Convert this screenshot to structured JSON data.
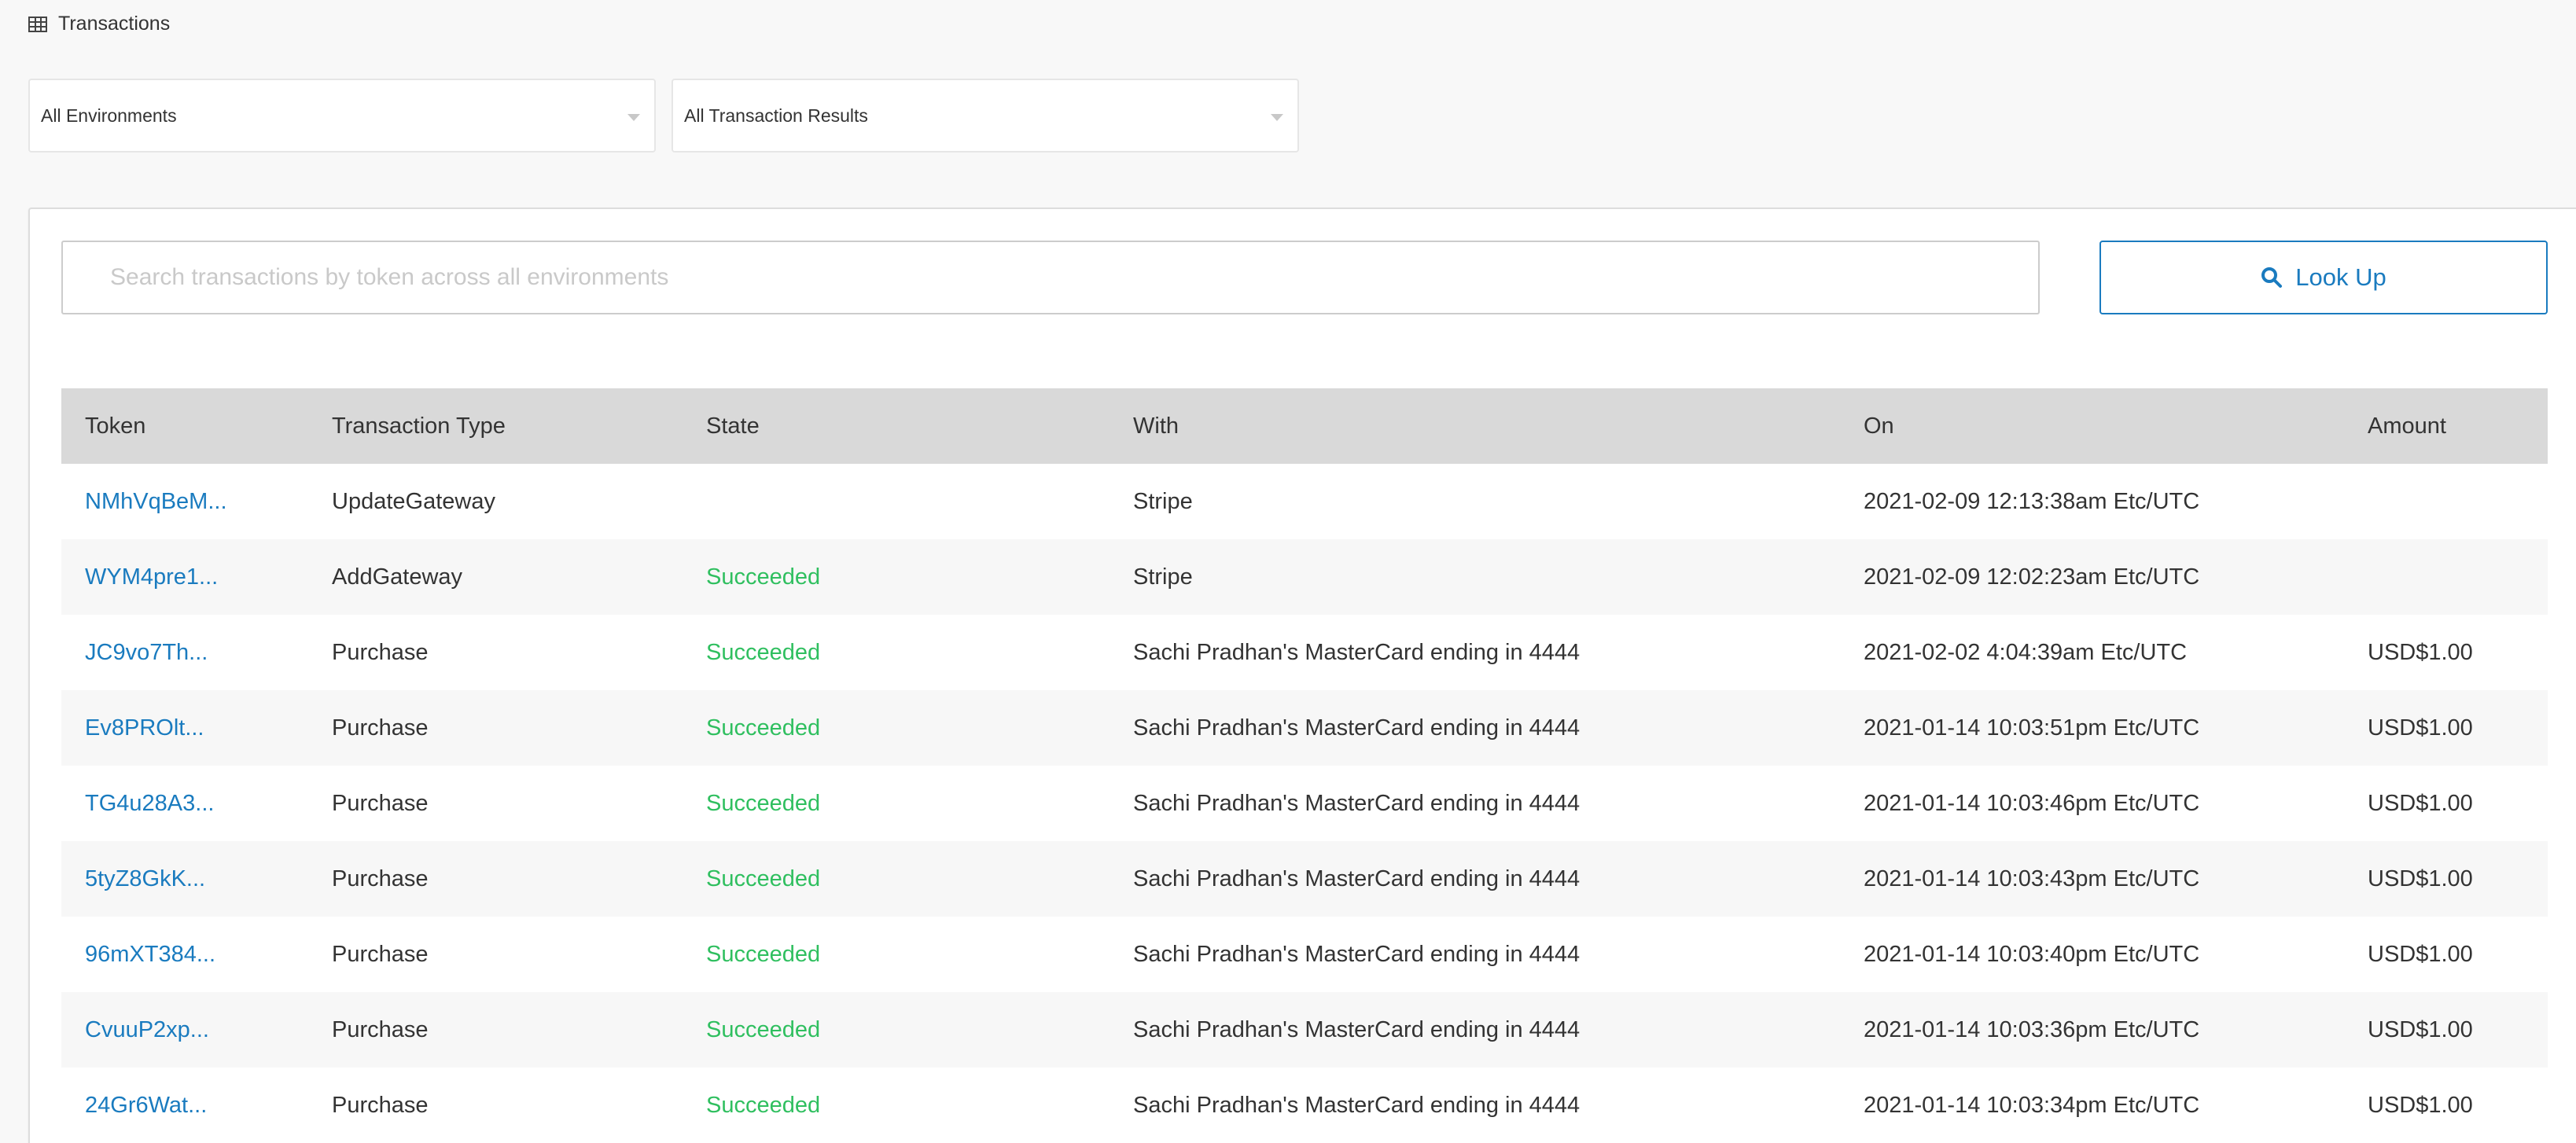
{
  "header": {
    "title": "Transactions",
    "icon": "table-grid-icon"
  },
  "filters": {
    "environment": {
      "selected": "All Environments"
    },
    "result": {
      "selected": "All Transaction Results"
    }
  },
  "search": {
    "placeholder": "Search transactions by token across all environments",
    "value": "",
    "button_label": "Look Up",
    "button_icon": "search-icon"
  },
  "colors": {
    "link": "#1a7bbf",
    "success": "#2fbf5f",
    "header_bg": "#d9d9d9"
  },
  "table": {
    "columns": [
      "Token",
      "Transaction Type",
      "State",
      "With",
      "On",
      "Amount"
    ],
    "rows": [
      {
        "token": "NMhVqBeM...",
        "type": "UpdateGateway",
        "state": "",
        "with": "Stripe",
        "on": "2021-02-09 12:13:38am Etc/UTC",
        "amount": ""
      },
      {
        "token": "WYM4pre1...",
        "type": "AddGateway",
        "state": "Succeeded",
        "with": "Stripe",
        "on": "2021-02-09 12:02:23am Etc/UTC",
        "amount": ""
      },
      {
        "token": "JC9vo7Th...",
        "type": "Purchase",
        "state": "Succeeded",
        "with": "Sachi Pradhan's MasterCard ending in 4444",
        "on": "2021-02-02 4:04:39am Etc/UTC",
        "amount": "USD$1.00"
      },
      {
        "token": "Ev8PROlt...",
        "type": "Purchase",
        "state": "Succeeded",
        "with": "Sachi Pradhan's MasterCard ending in 4444",
        "on": "2021-01-14 10:03:51pm Etc/UTC",
        "amount": "USD$1.00"
      },
      {
        "token": "TG4u28A3...",
        "type": "Purchase",
        "state": "Succeeded",
        "with": "Sachi Pradhan's MasterCard ending in 4444",
        "on": "2021-01-14 10:03:46pm Etc/UTC",
        "amount": "USD$1.00"
      },
      {
        "token": "5tyZ8GkK...",
        "type": "Purchase",
        "state": "Succeeded",
        "with": "Sachi Pradhan's MasterCard ending in 4444",
        "on": "2021-01-14 10:03:43pm Etc/UTC",
        "amount": "USD$1.00"
      },
      {
        "token": "96mXT384...",
        "type": "Purchase",
        "state": "Succeeded",
        "with": "Sachi Pradhan's MasterCard ending in 4444",
        "on": "2021-01-14 10:03:40pm Etc/UTC",
        "amount": "USD$1.00"
      },
      {
        "token": "CvuuP2xp...",
        "type": "Purchase",
        "state": "Succeeded",
        "with": "Sachi Pradhan's MasterCard ending in 4444",
        "on": "2021-01-14 10:03:36pm Etc/UTC",
        "amount": "USD$1.00"
      },
      {
        "token": "24Gr6Wat...",
        "type": "Purchase",
        "state": "Succeeded",
        "with": "Sachi Pradhan's MasterCard ending in 4444",
        "on": "2021-01-14 10:03:34pm Etc/UTC",
        "amount": "USD$1.00"
      }
    ]
  }
}
